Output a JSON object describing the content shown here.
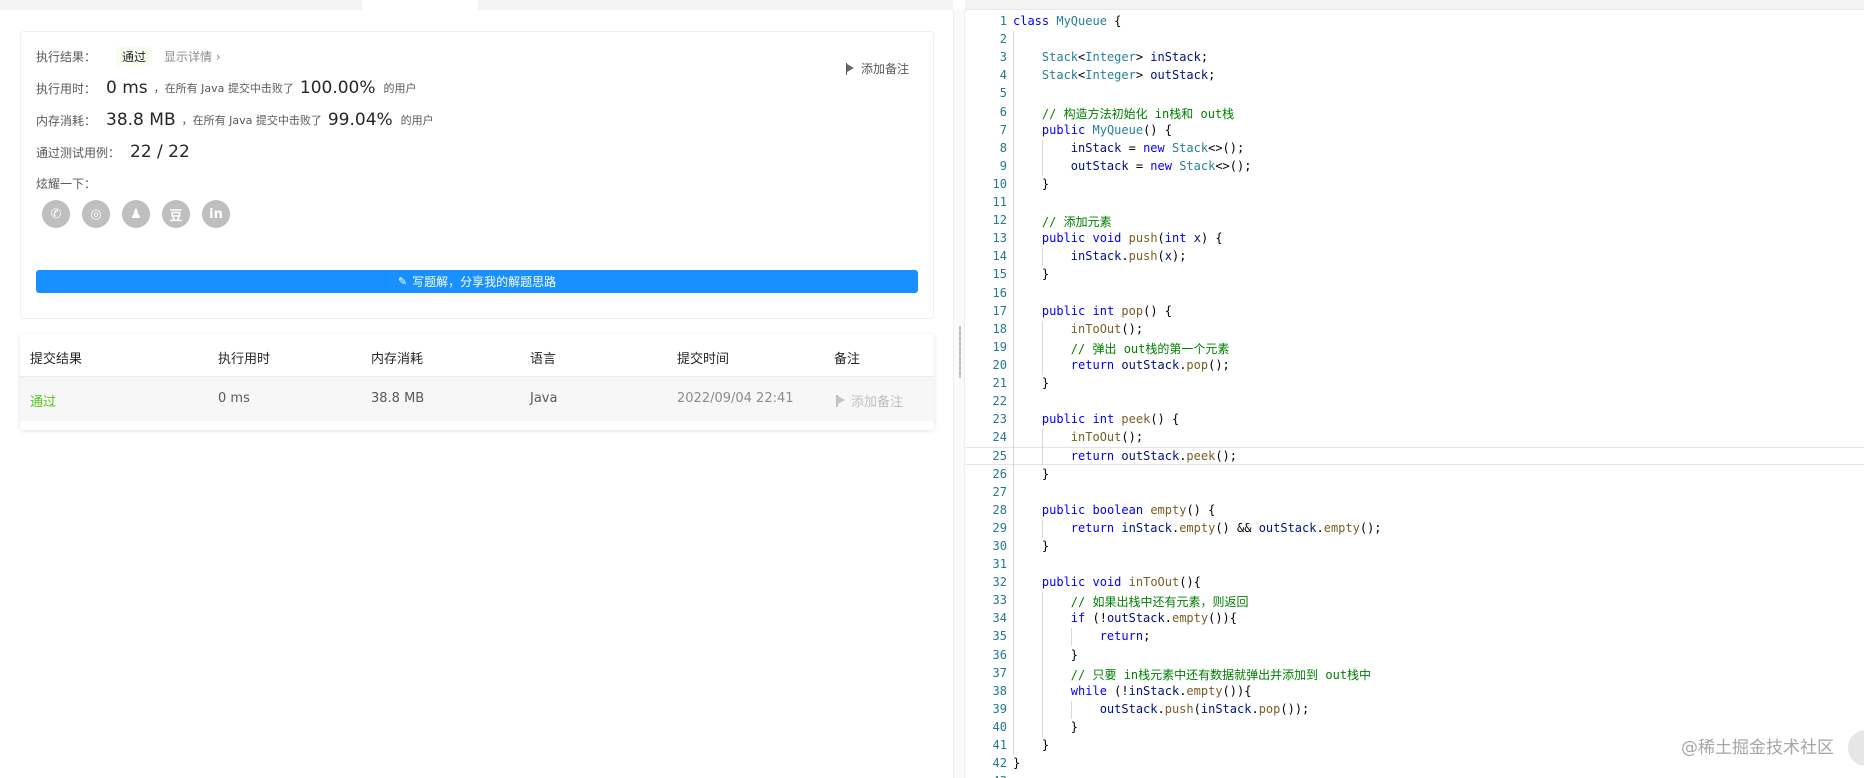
{
  "result": {
    "exec_result_label": "执行结果：",
    "status": "通过",
    "show_detail": "显示详情 ›",
    "add_note": "添加备注",
    "runtime_label": "执行用时：",
    "runtime_value": "0 ms",
    "runtime_text": "，在所有 Java 提交中击败了",
    "runtime_pct": "100.00%",
    "users_text": "的用户",
    "memory_label": "内存消耗：",
    "memory_value": "38.8 MB",
    "memory_text": "，在所有 Java 提交中击败了",
    "memory_pct": "99.04%",
    "testcases_label": "通过测试用例：",
    "testcases_value": "22 / 22",
    "share_label": "炫耀一下：",
    "share_icons": [
      "wechat-icon",
      "weibo-icon",
      "qq-icon",
      "douban-icon",
      "linkedin-icon"
    ],
    "write_button": "写题解，分享我的解题思路"
  },
  "submissions": {
    "headers": [
      "提交结果",
      "执行用时",
      "内存消耗",
      "语言",
      "提交时间",
      "备注"
    ],
    "rows": [
      {
        "result": "通过",
        "runtime": "0 ms",
        "memory": "38.8 MB",
        "language": "Java",
        "time": "2022/09/04 22:41",
        "note": "添加备注"
      }
    ]
  },
  "editor": {
    "active_line": 25,
    "lines": [
      "class MyQueue {",
      "",
      "    Stack<Integer> inStack;",
      "    Stack<Integer> outStack;",
      "",
      "    // 构造方法初始化 in栈和 out栈",
      "    public MyQueue() {",
      "        inStack = new Stack<>();",
      "        outStack = new Stack<>();",
      "    }",
      "",
      "    // 添加元素",
      "    public void push(int x) {",
      "        inStack.push(x);",
      "    }",
      "",
      "    public int pop() {",
      "        inToOut();",
      "        // 弹出 out栈的第一个元素",
      "        return outStack.pop();",
      "    }",
      "",
      "    public int peek() {",
      "        inToOut();",
      "        return outStack.peek();",
      "    }",
      "",
      "    public boolean empty() {",
      "        return inStack.empty() && outStack.empty();",
      "    }",
      "",
      "    public void inToOut(){",
      "        // 如果出栈中还有元素，则返回",
      "        if (!outStack.empty()){",
      "            return;",
      "        }",
      "        // 只要 in栈元素中还有数据就弹出并添加到 out栈中",
      "        while (!inStack.empty()){",
      "            outStack.push(inStack.pop());",
      "        }",
      "    }",
      "}",
      ""
    ]
  },
  "watermark": "@稀土掘金技术社区",
  "colors": {
    "accent": "#1890ff",
    "pass": "#52c41a"
  }
}
